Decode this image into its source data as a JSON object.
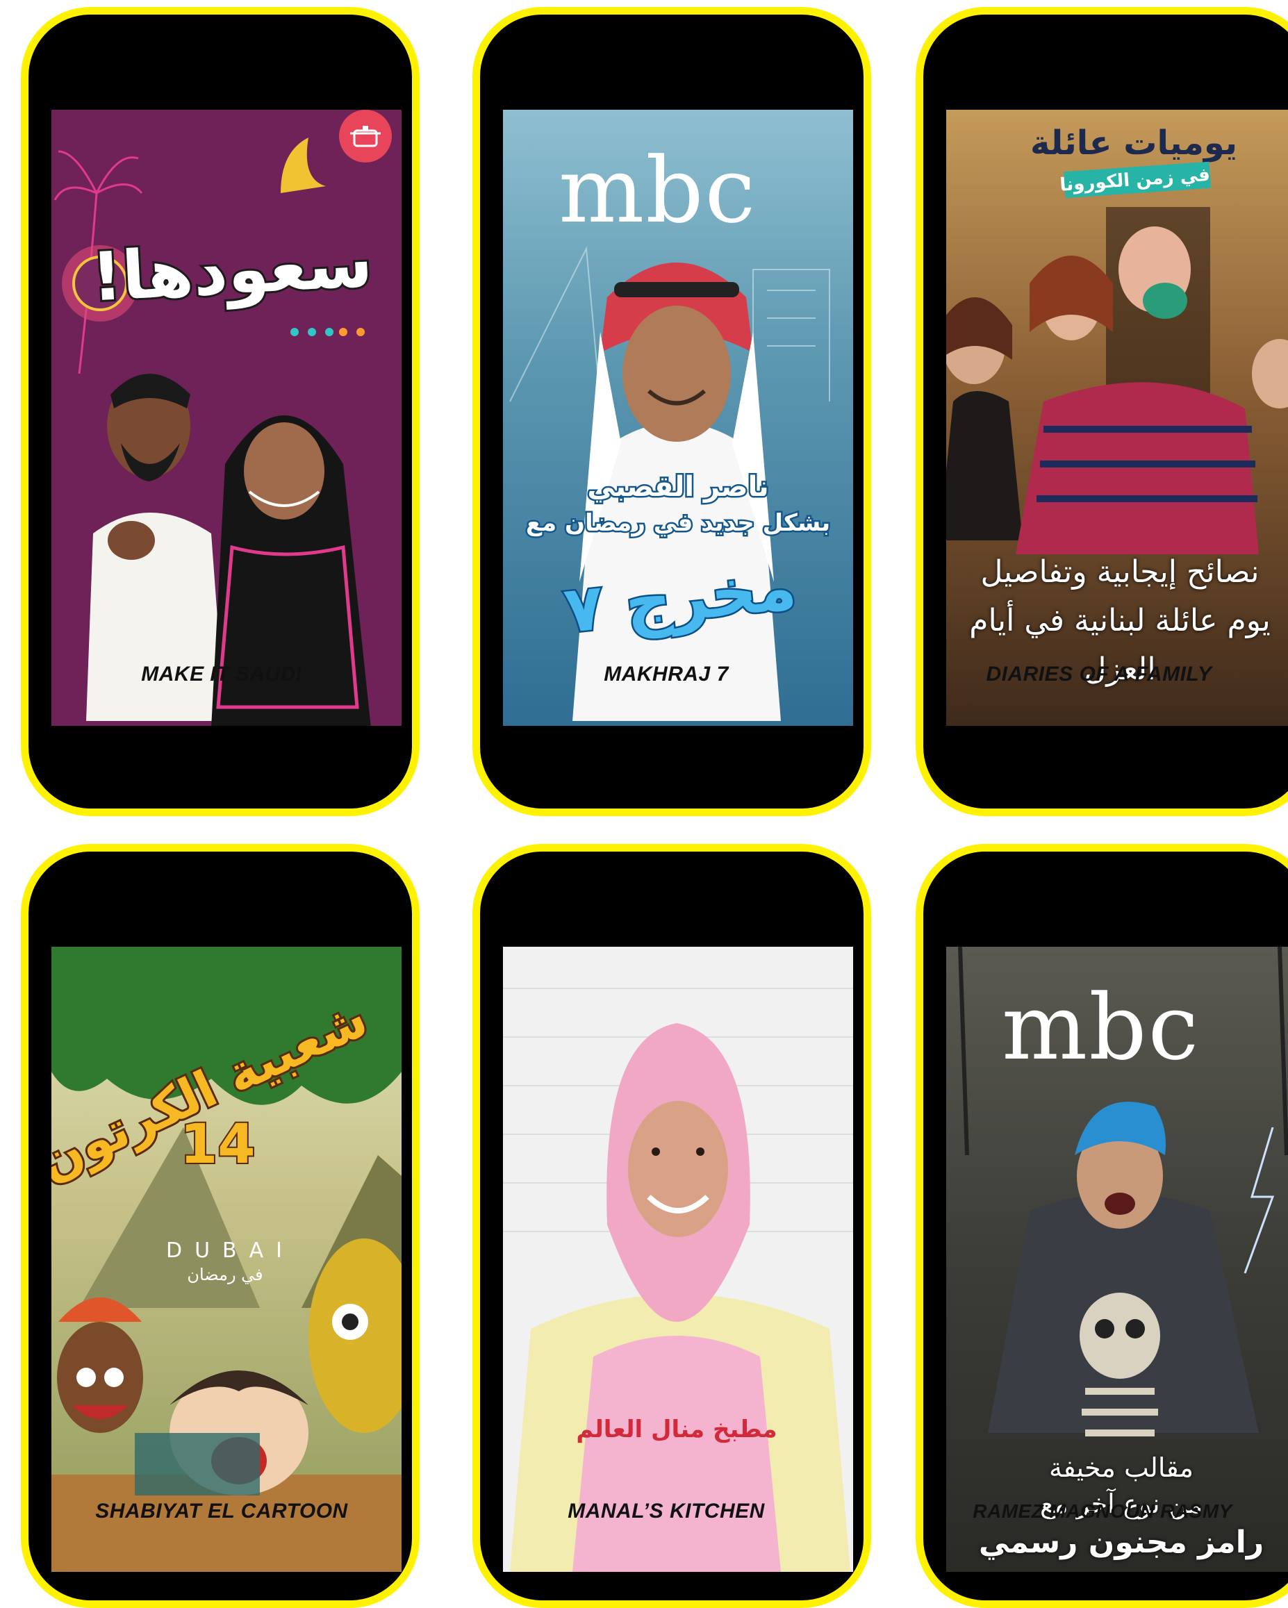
{
  "colors": {
    "frame": "#fff200",
    "banner": "#fff133"
  },
  "cards": [
    {
      "id": "make-it-saudi",
      "banner_label": "MAKE IT SAUDI",
      "art_title": "سعودها!",
      "icon": "cooking-pot-icon"
    },
    {
      "id": "makhraj-7",
      "banner_label": "MAKHRAJ 7",
      "logo": "mbc",
      "art_lines": [
        "ناصر القصبي",
        "بشكل جديد في رمضان مع"
      ],
      "art_title": "مخرج ٧"
    },
    {
      "id": "diaries-of-a-family",
      "banner_label": "DIARIES OF A FAMILY",
      "art_title": "يوميات عائلة",
      "art_subtitle": "في زمن الكورونا",
      "art_lines": [
        "نصائح إيجابية وتفاصيل",
        "يوم عائلة لبنانية في أيام",
        "العزل"
      ]
    },
    {
      "id": "shabiyat-el-cartoon",
      "banner_label": "SHABIYAT EL CARTOON",
      "art_title": "شعبية الكرتون",
      "art_number": "14",
      "channel_name": "DUBAI",
      "channel_sub": "في رمضان"
    },
    {
      "id": "manals-kitchen",
      "banner_label": "MANAL’S KITCHEN",
      "apron_text": "مطبخ منال العالم"
    },
    {
      "id": "ramez-magnoun-rasmy",
      "banner_label": "RAMEZ MAGNOUN RASMY",
      "logo": "mbc",
      "art_lines": [
        "مقالب مخيفة",
        "من نوع آخر مع",
        "رامز مجنون رسمي"
      ]
    }
  ]
}
